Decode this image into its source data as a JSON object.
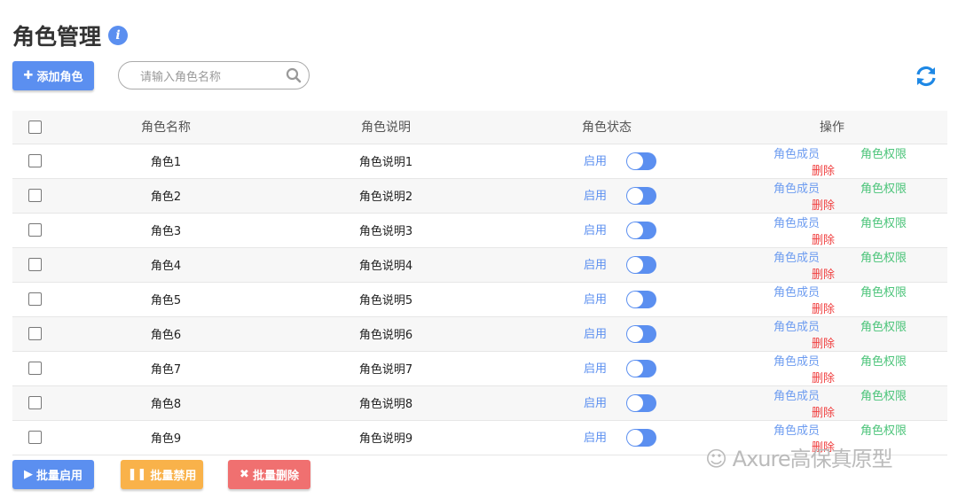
{
  "title": "角色管理",
  "info_icon": "i",
  "toolbar": {
    "add_label": "添加角色",
    "search_placeholder": "请输入角色名称"
  },
  "table": {
    "headers": [
      "角色名称",
      "角色说明",
      "角色状态",
      "操作"
    ],
    "rows": [
      {
        "name": "角色1",
        "desc": "角色说明1",
        "status": "启用",
        "enabled": true
      },
      {
        "name": "角色2",
        "desc": "角色说明2",
        "status": "启用",
        "enabled": true
      },
      {
        "name": "角色3",
        "desc": "角色说明3",
        "status": "启用",
        "enabled": true
      },
      {
        "name": "角色4",
        "desc": "角色说明4",
        "status": "启用",
        "enabled": true
      },
      {
        "name": "角色5",
        "desc": "角色说明5",
        "status": "启用",
        "enabled": true
      },
      {
        "name": "角色6",
        "desc": "角色说明6",
        "status": "启用",
        "enabled": true
      },
      {
        "name": "角色7",
        "desc": "角色说明7",
        "status": "启用",
        "enabled": true
      },
      {
        "name": "角色8",
        "desc": "角色说明8",
        "status": "启用",
        "enabled": true
      },
      {
        "name": "角色9",
        "desc": "角色说明9",
        "status": "启用",
        "enabled": true
      }
    ],
    "actions": {
      "members": "角色成员",
      "permissions": "角色权限",
      "delete": "删除"
    }
  },
  "bulk": {
    "enable": "批量启用",
    "disable": "批量禁用",
    "delete": "批量删除"
  },
  "watermark": "Axure高保真原型",
  "colors": {
    "primary": "#5b8ff0",
    "warning": "#f9b24a",
    "danger": "#f07070",
    "success": "#4cc47a"
  }
}
